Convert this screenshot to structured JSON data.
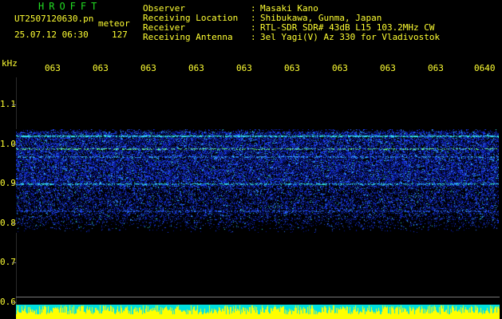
{
  "header": {
    "app_title": "HROFFT",
    "file_name": "UT2507120630.pn",
    "meteor_label": "meteor",
    "date_time": "25.07.12 06:30",
    "count": "127"
  },
  "info": [
    {
      "label": "Observer",
      "value": "Masaki Kano"
    },
    {
      "label": "Receiving Location",
      "value": "Shibukawa, Gunma, Japan"
    },
    {
      "label": "Receiver",
      "value": "RTL-SDR SDR# 43dB L15 103.2MHz CW"
    },
    {
      "label": "Receiving Antenna",
      "value": "3el Yagi(V) Az 330 for Vladivostok"
    }
  ],
  "info_separator": ":",
  "axis": {
    "unit": "kHz",
    "time_labels": [
      "063",
      "063",
      "063",
      "063",
      "063",
      "063",
      "063",
      "063",
      "063",
      "0640"
    ],
    "freq_labels": [
      "1.1",
      "1.0",
      "0.9",
      "0.8",
      "0.7",
      "0.6"
    ]
  },
  "colors": {
    "title": "#22dd22",
    "text": "#ffff33",
    "signal_blue": "#1a3cff",
    "signal_cyan": "#33e6e6",
    "strip_yellow": "#ffff00"
  }
}
